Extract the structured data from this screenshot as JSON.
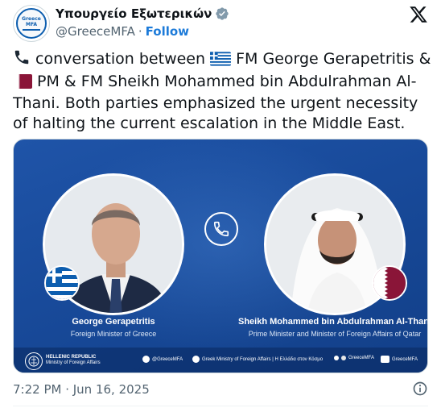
{
  "account": {
    "avatar_line1": "Greece",
    "avatar_line2": "MFA",
    "display_name": "Υπουργείο Εξωτερικών",
    "handle": "@GreeceMFA",
    "separator": "·",
    "follow_label": "Follow",
    "verified_icon": "verified-badge-icon",
    "platform_icon": "x-logo-icon"
  },
  "tweet": {
    "emoji_phone": "📞",
    "text_part1": " conversation between ",
    "text_part2": " FM George Gerapetritis & ",
    "text_part3": " PM & FM Sheikh Mohammed bin Abdulrahman Al-Thani. Both parties emphasized the urgent necessity of halting the current escalation in the Middle East."
  },
  "media": {
    "left_person": {
      "name": "George Gerapetritis",
      "title": "Foreign Minister of Greece"
    },
    "right_person": {
      "name": "Sheikh Mohammed bin Abdulrahman Al-Thani",
      "title": "Prime Minister and Minister of Foreign Affairs of Qatar"
    },
    "footer": {
      "ministry_line1": "HELLENIC REPUBLIC",
      "ministry_line2": "Ministry of Foreign Affairs",
      "twitter": "@GreeceMFA",
      "facebook": "Greek Ministry of Foreign Affairs | Η Ελλάδα στον Κόσμο",
      "flickr": "GreeceMFA",
      "youtube": "GreeceMFA"
    }
  },
  "meta": {
    "timestamp": "7:22 PM · Jun 16, 2025",
    "info_icon": "info-icon"
  },
  "colors": {
    "follow": "#1d7bd9",
    "verified": "#829aab",
    "media_blue": "#1a4c9c",
    "greece_blue": "#0d5eaf",
    "qatar_maroon": "#8a1538"
  }
}
